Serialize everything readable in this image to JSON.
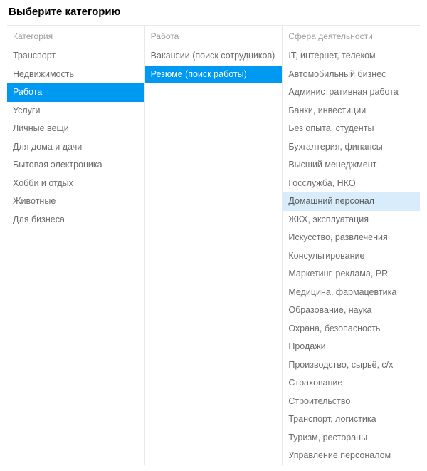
{
  "title": "Выберите категорию",
  "columns": [
    {
      "header": "Категория",
      "items": [
        {
          "label": "Транспорт",
          "state": "normal"
        },
        {
          "label": "Недвижимость",
          "state": "normal"
        },
        {
          "label": "Работа",
          "state": "selected"
        },
        {
          "label": "Услуги",
          "state": "normal"
        },
        {
          "label": "Личные вещи",
          "state": "normal"
        },
        {
          "label": "Для дома и дачи",
          "state": "normal"
        },
        {
          "label": "Бытовая электроника",
          "state": "normal"
        },
        {
          "label": "Хобби и отдых",
          "state": "normal"
        },
        {
          "label": "Животные",
          "state": "normal"
        },
        {
          "label": "Для бизнеса",
          "state": "normal"
        }
      ]
    },
    {
      "header": "Работа",
      "items": [
        {
          "label": "Вакансии (поиск сотрудников)",
          "state": "normal"
        },
        {
          "label": "Резюме (поиск работы)",
          "state": "selected"
        }
      ]
    },
    {
      "header": "Сфера деятельности",
      "items": [
        {
          "label": "IT, интернет, телеком",
          "state": "normal"
        },
        {
          "label": "Автомобильный бизнес",
          "state": "normal"
        },
        {
          "label": "Административная работа",
          "state": "normal"
        },
        {
          "label": "Банки, инвестиции",
          "state": "normal"
        },
        {
          "label": "Без опыта, студенты",
          "state": "normal"
        },
        {
          "label": "Бухгалтерия, финансы",
          "state": "normal"
        },
        {
          "label": "Высший менеджмент",
          "state": "normal"
        },
        {
          "label": "Госслужба, НКО",
          "state": "normal"
        },
        {
          "label": "Домашний персонал",
          "state": "hovered"
        },
        {
          "label": "ЖКХ, эксплуатация",
          "state": "normal"
        },
        {
          "label": "Искусство, развлечения",
          "state": "normal"
        },
        {
          "label": "Консультирование",
          "state": "normal"
        },
        {
          "label": "Маркетинг, реклама, PR",
          "state": "normal"
        },
        {
          "label": "Медицина, фармацевтика",
          "state": "normal"
        },
        {
          "label": "Образование, наука",
          "state": "normal"
        },
        {
          "label": "Охрана, безопасность",
          "state": "normal"
        },
        {
          "label": "Продажи",
          "state": "normal"
        },
        {
          "label": "Производство, сырьё, с/х",
          "state": "normal"
        },
        {
          "label": "Страхование",
          "state": "normal"
        },
        {
          "label": "Строительство",
          "state": "normal"
        },
        {
          "label": "Транспорт, логистика",
          "state": "normal"
        },
        {
          "label": "Туризм, рестораны",
          "state": "normal"
        },
        {
          "label": "Управление персоналом",
          "state": "normal"
        }
      ]
    }
  ]
}
